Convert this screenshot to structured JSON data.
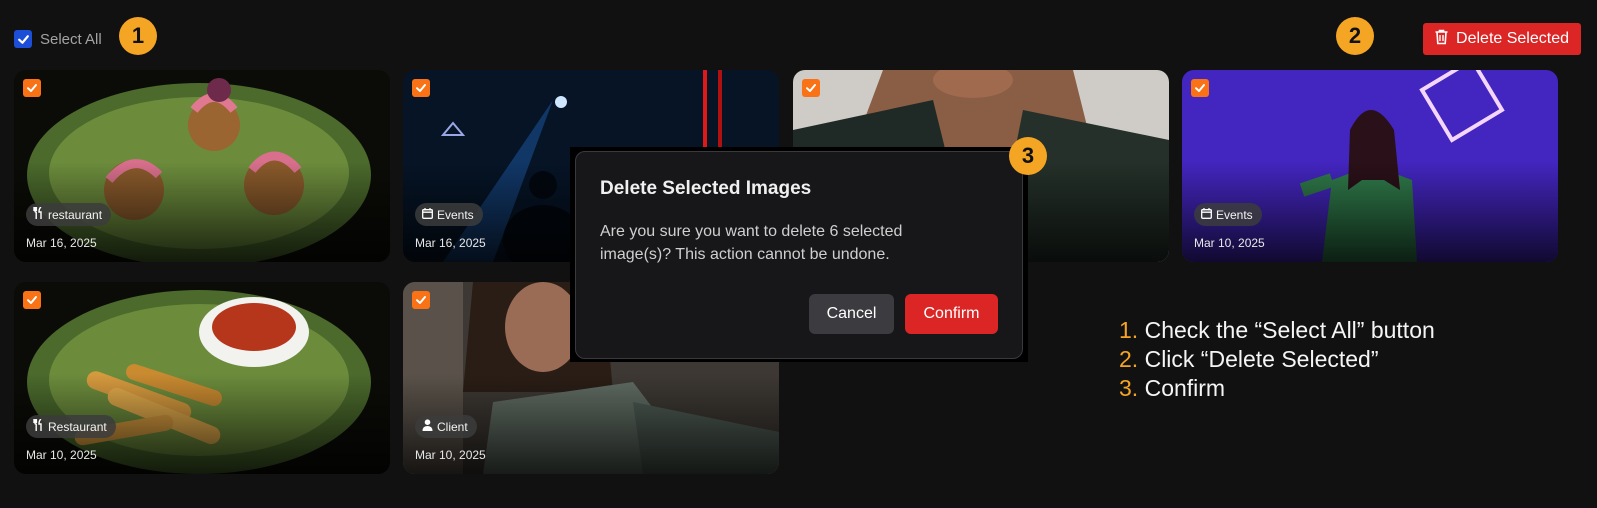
{
  "toolbar": {
    "select_all_label": "Select All",
    "delete_label": "Delete Selected"
  },
  "steps_badges": [
    "1",
    "2",
    "3"
  ],
  "cards": [
    {
      "category_icon": "utensils-icon",
      "category": "restaurant",
      "date": "Mar 16, 2025",
      "selected": true
    },
    {
      "category_icon": "calendar-icon",
      "category": "Events",
      "date": "Mar 16, 2025",
      "selected": true
    },
    {
      "category_icon": "calendar-icon",
      "category": "",
      "date": "",
      "selected": true
    },
    {
      "category_icon": "calendar-icon",
      "category": "Events",
      "date": "Mar 10, 2025",
      "selected": true
    },
    {
      "category_icon": "utensils-icon",
      "category": "Restaurant",
      "date": "Mar 10, 2025",
      "selected": true
    },
    {
      "category_icon": "user-icon",
      "category": "Client",
      "date": "Mar 10, 2025",
      "selected": true
    }
  ],
  "modal": {
    "title": "Delete Selected Images",
    "message": "Are you sure you want to delete 6 selected image(s)? This action cannot be undone.",
    "cancel_label": "Cancel",
    "confirm_label": "Confirm"
  },
  "instructions": [
    {
      "num": "1.",
      "text": "Check the “Select All” button"
    },
    {
      "num": "2.",
      "text": "Click “Delete Selected”"
    },
    {
      "num": "3.",
      "text": "Confirm"
    }
  ],
  "colors": {
    "background": "#111111",
    "accent_orange": "#f5a524",
    "checkbox_orange": "#f97316",
    "danger_red": "#dc2626",
    "select_all_blue": "#1d4ed8"
  }
}
